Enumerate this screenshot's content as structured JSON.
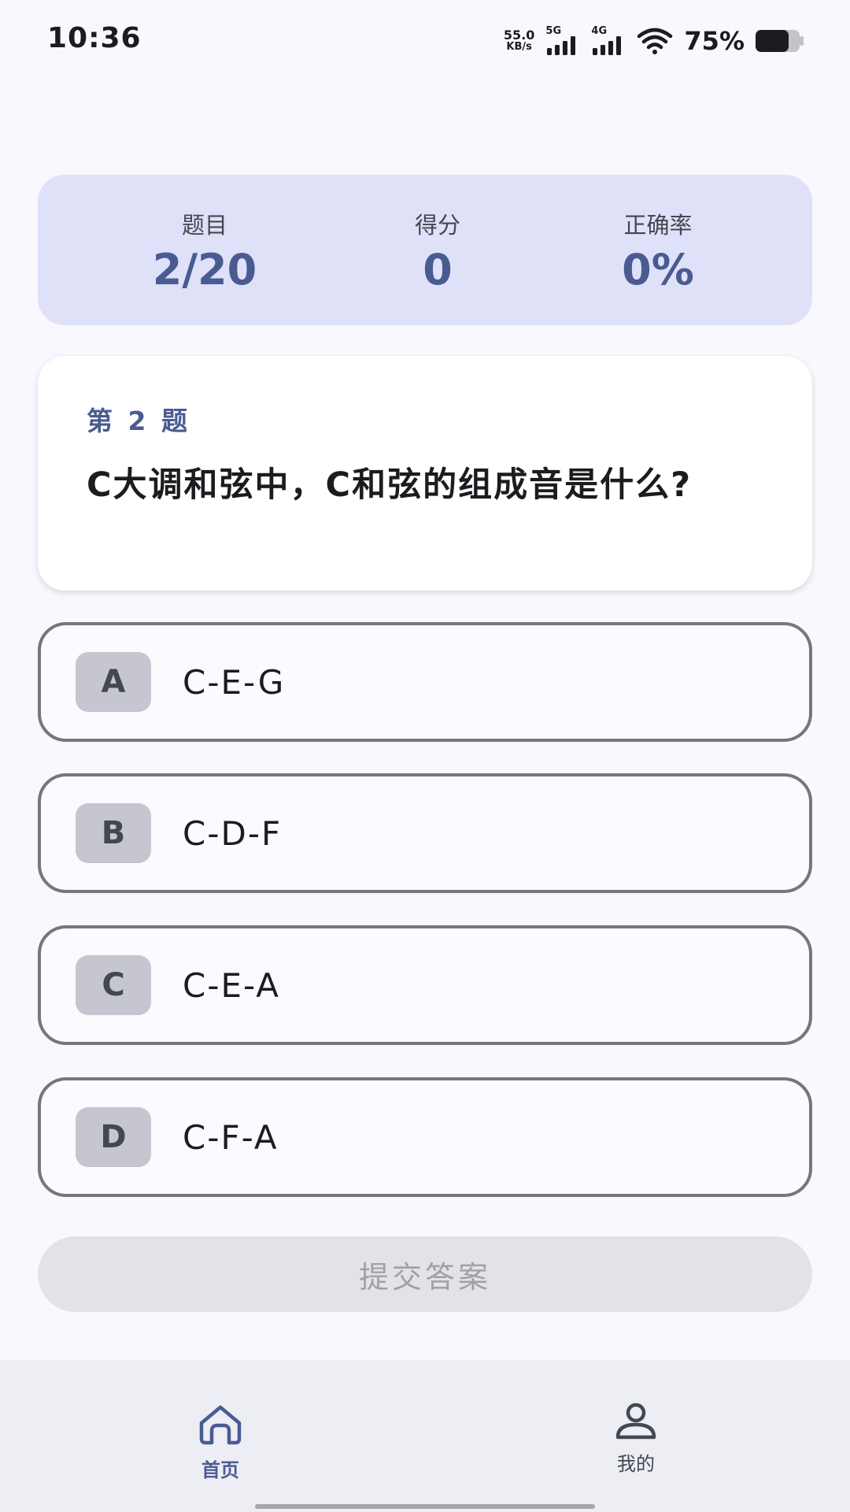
{
  "status_bar": {
    "time": "10:36",
    "net_speed_value": "55.0",
    "net_speed_unit": "KB/s",
    "signal1_label": "5G",
    "signal2_label": "4G",
    "battery_percent": "75%",
    "battery_level": 0.75
  },
  "stats": {
    "question_label": "题目",
    "question_value": "2/20",
    "score_label": "得分",
    "score_value": "0",
    "accuracy_label": "正确率",
    "accuracy_value": "0%"
  },
  "question": {
    "number": "第 2 题",
    "text": "C大调和弦中，C和弦的组成音是什么?"
  },
  "options": [
    {
      "letter": "A",
      "text": "C-E-G"
    },
    {
      "letter": "B",
      "text": "C-D-F"
    },
    {
      "letter": "C",
      "text": "C-E-A"
    },
    {
      "letter": "D",
      "text": "C-F-A"
    }
  ],
  "submit": {
    "label": "提交答案"
  },
  "nav": {
    "home_label": "首页",
    "profile_label": "我的"
  },
  "colors": {
    "primary": "#4A5B92",
    "stats_background": "#DFE1F9",
    "background": "#F8F8FE",
    "outline": "#74777F"
  }
}
